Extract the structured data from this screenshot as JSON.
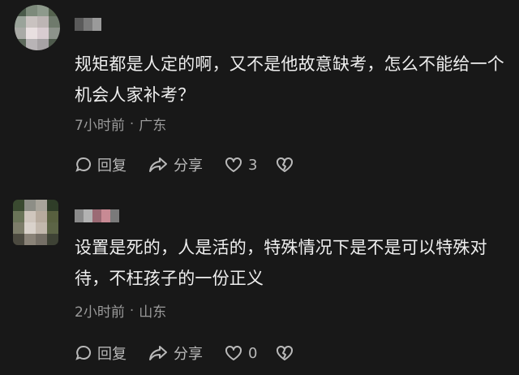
{
  "comments": [
    {
      "text": "规矩都是人定的啊，又不是他故意缺考，怎么不能给一个机会人家补考？",
      "time": "7小时前",
      "separator": "·",
      "location": "广东",
      "reply_label": "回复",
      "share_label": "分享",
      "like_count": "3"
    },
    {
      "text": "设置是死的，人是活的，特殊情况下是不是可以特殊对待，不枉孩子的一份正义",
      "time": "2小时前",
      "separator": "·",
      "location": "山东",
      "reply_label": "回复",
      "share_label": "分享",
      "like_count": "0"
    }
  ],
  "icons": {
    "reply": "reply-bubble-icon",
    "share": "share-arrow-icon",
    "like": "heart-icon",
    "dislike": "broken-heart-icon"
  },
  "colors": {
    "background": "#181818",
    "text": "#eeeeee",
    "meta": "#9a9a9a",
    "action": "#b9b9b9"
  }
}
